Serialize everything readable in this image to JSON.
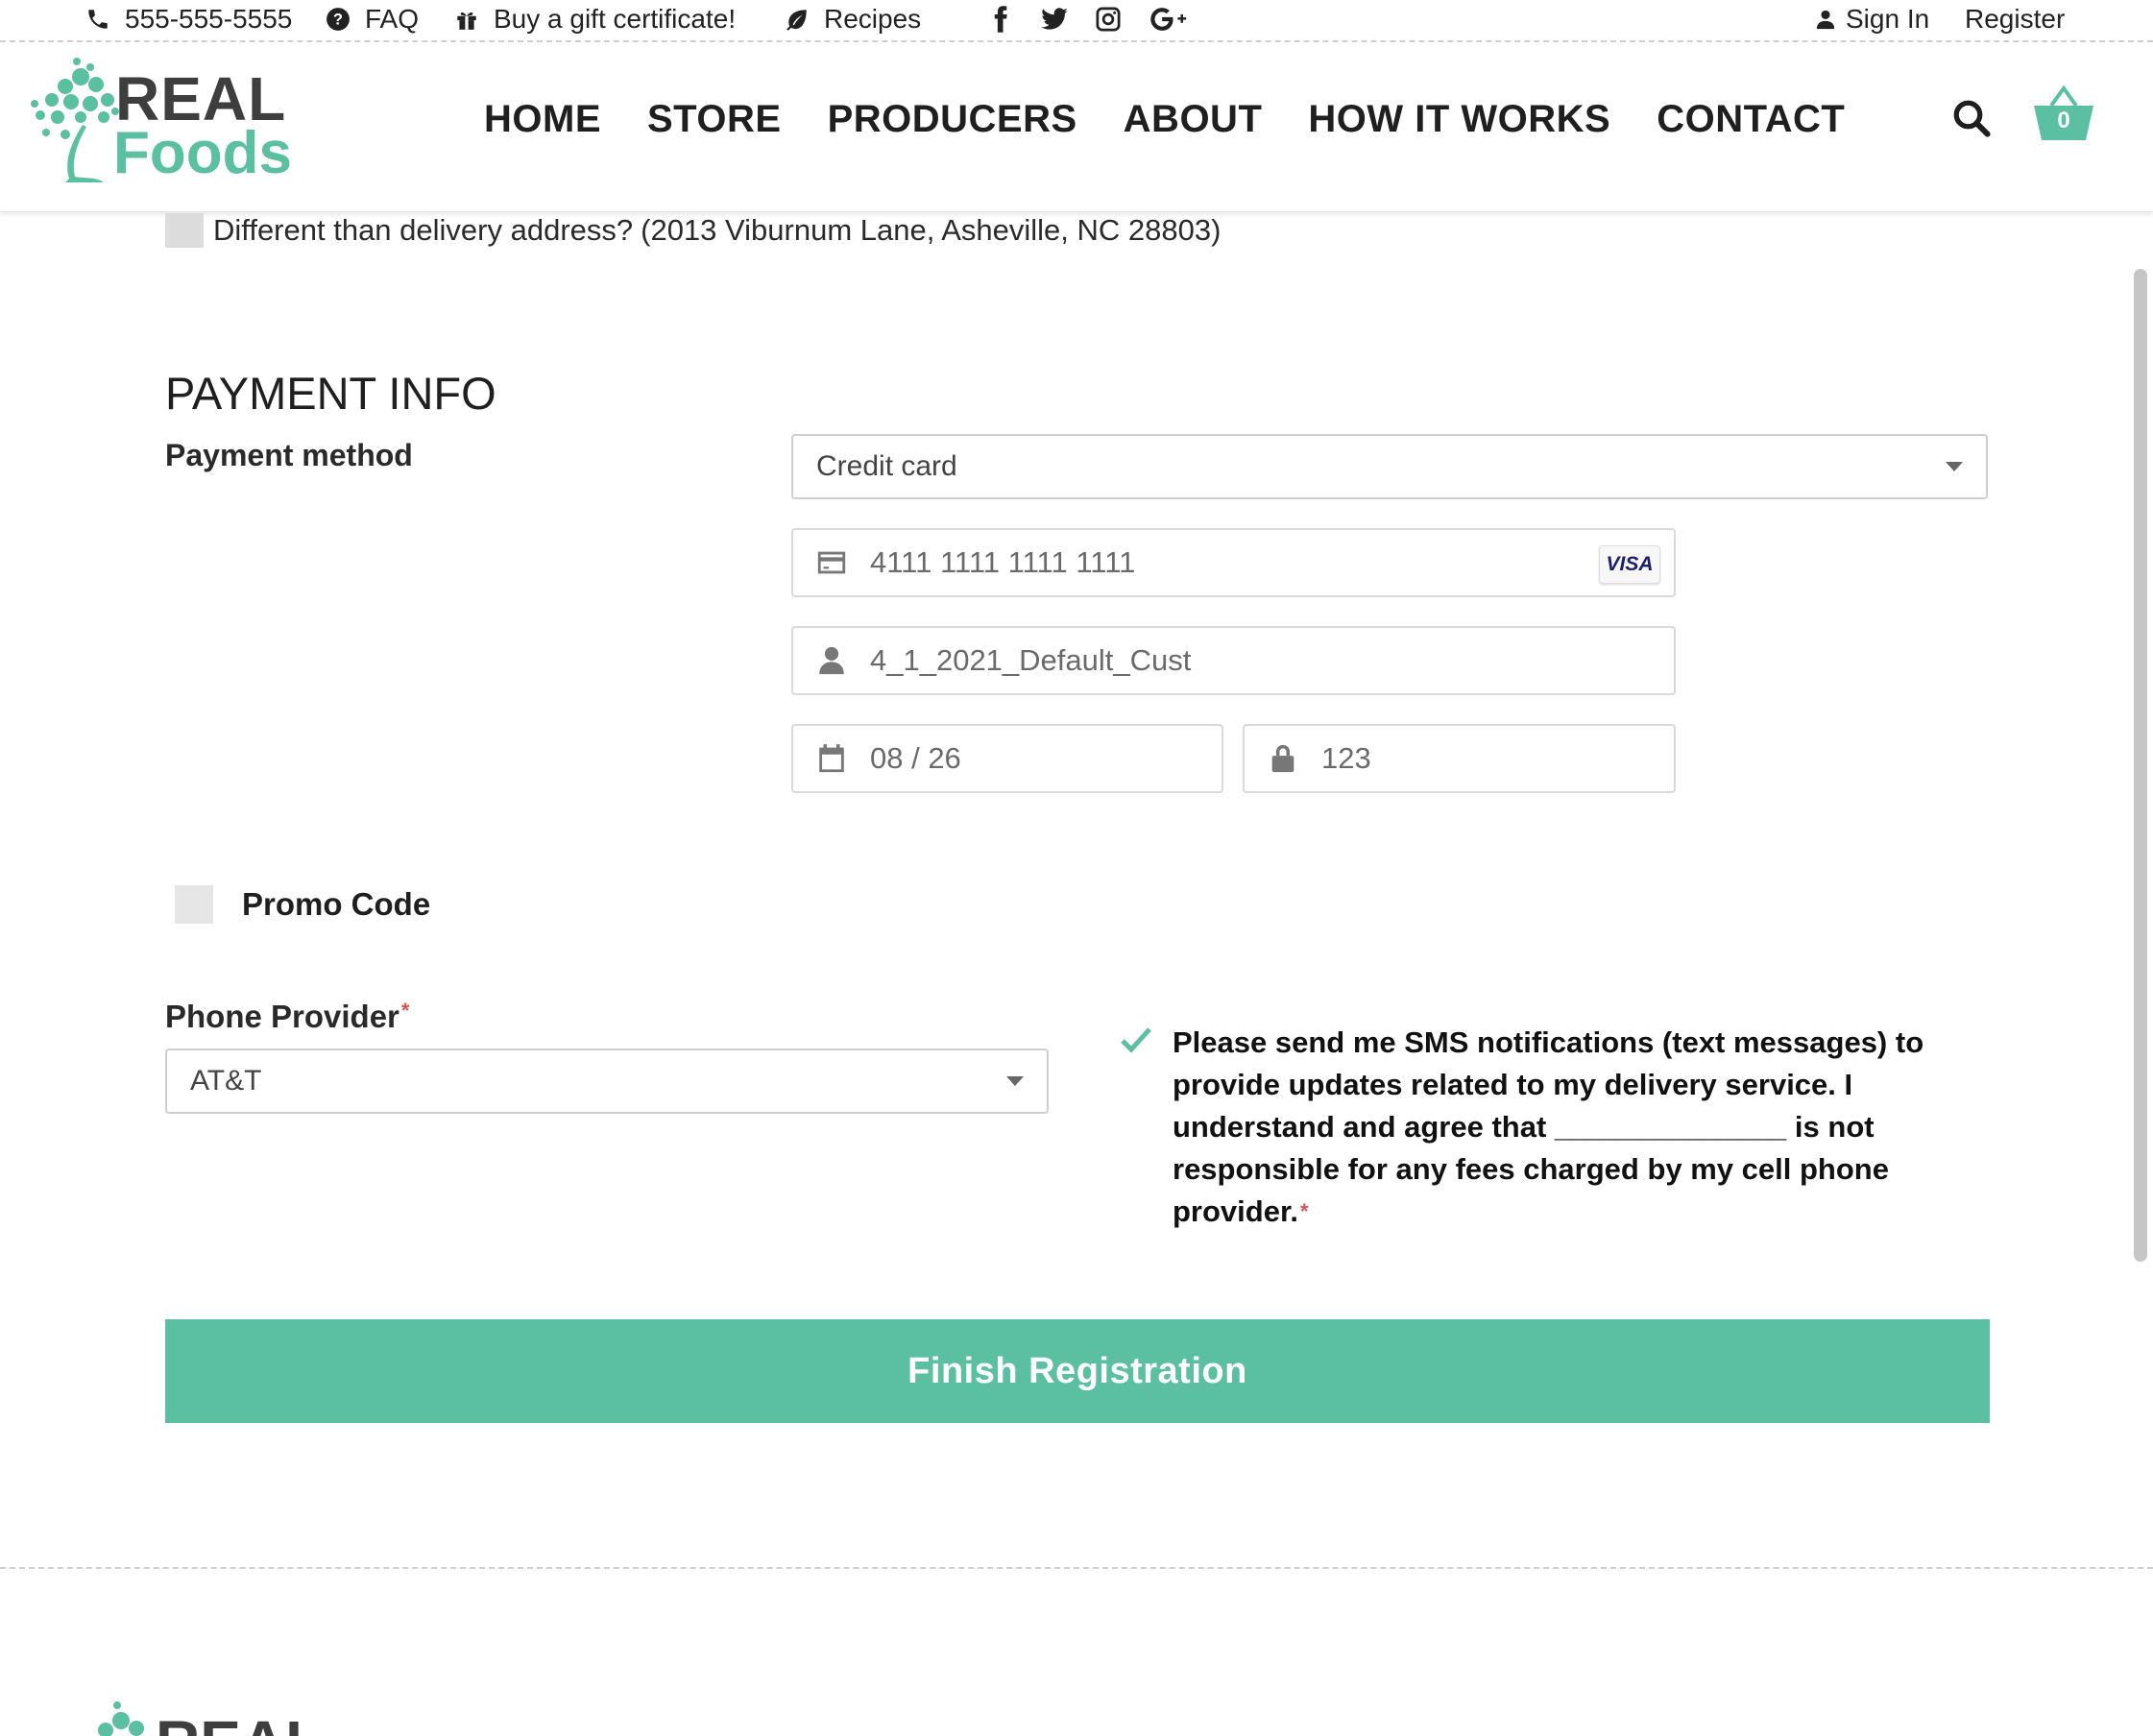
{
  "topbar": {
    "phone": "555-555-5555",
    "faq": "FAQ",
    "gift": "Buy a gift certificate!",
    "recipes": "Recipes",
    "sign_in": "Sign In",
    "register": "Register",
    "social_icons": [
      "facebook-icon",
      "twitter-icon",
      "instagram-icon",
      "google-plus-icon"
    ]
  },
  "header": {
    "logo_top": "REAL",
    "logo_bottom": "Foods",
    "nav": [
      "HOME",
      "STORE",
      "PRODUCERS",
      "ABOUT",
      "HOW IT WORKS",
      "CONTACT"
    ],
    "cart_count": "0"
  },
  "billing": {
    "different_label": "Different than delivery address?",
    "delivery_address": "(2013 Viburnum Lane, Asheville, NC 28803)"
  },
  "payment": {
    "title": "PAYMENT INFO",
    "method_label": "Payment method",
    "method_value": "Credit card",
    "card_number": "4111 1111 1111 1111",
    "card_brand": "VISA",
    "cardholder": "4_1_2021_Default_Cust",
    "expiry": "08 / 26",
    "cvc": "123"
  },
  "promo": {
    "label": "Promo Code"
  },
  "phone_provider": {
    "label": "Phone Provider",
    "required_mark": "*",
    "value": "AT&T"
  },
  "sms_consent": {
    "checked": true,
    "line1": "Please send me SMS notifications (text messages) to",
    "line2": "provide updates related to my delivery service. I",
    "line3_a": "understand and agree that",
    "line3_blank": "______________",
    "line3_b": "is not",
    "line4": "responsible for any fees charged by my cell phone",
    "line5": "provider.",
    "required_mark": "*"
  },
  "actions": {
    "finish": "Finish Registration"
  },
  "footer": {
    "logo_top": "REAL"
  },
  "colors": {
    "brand": "#5bbfa2",
    "required": "#d9534f",
    "text": "#222222"
  }
}
